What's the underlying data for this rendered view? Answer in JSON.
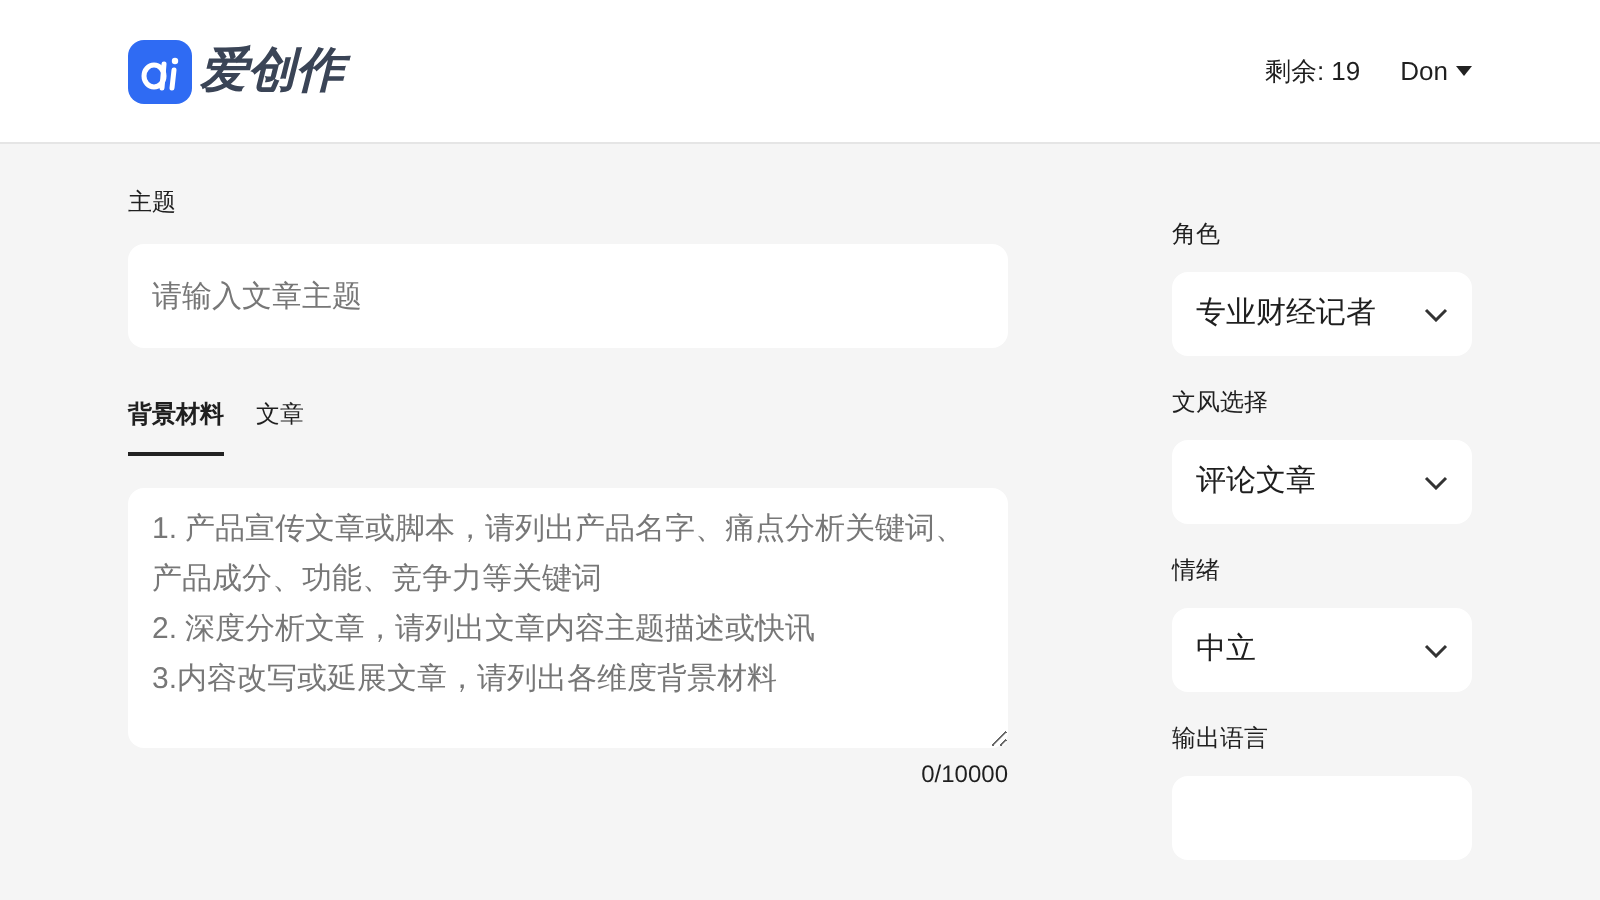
{
  "header": {
    "logo_text": "爱创作",
    "credits": "剩余: 19",
    "user": "Don"
  },
  "topic": {
    "label": "主题",
    "placeholder": "请输入文章主题"
  },
  "tabs": [
    {
      "label": "背景材料",
      "selected": true
    },
    {
      "label": "文章",
      "selected": false
    }
  ],
  "material": {
    "placeholder": "1. 产品宣传文章或脚本，请列出产品名字、痛点分析关键词、产品成分、功能、竞争力等关键词\n2. 深度分析文章，请列出文章内容主题描述或快讯\n3.内容改写或延展文章，请列出各维度背景材料",
    "counter": "0/10000"
  },
  "options": [
    {
      "label": "角色",
      "value": "专业财经记者"
    },
    {
      "label": "文风选择",
      "value": "评论文章"
    },
    {
      "label": "情绪",
      "value": "中立"
    },
    {
      "label": "输出语言"
    }
  ]
}
